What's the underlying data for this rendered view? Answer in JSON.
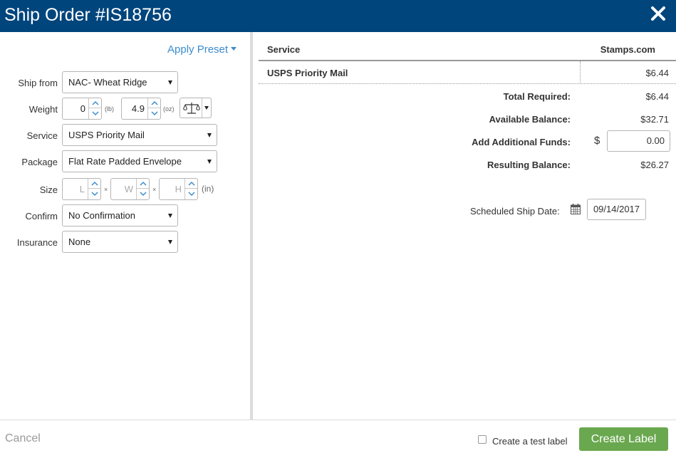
{
  "header": {
    "title": "Ship Order #IS18756",
    "close_icon": "close-icon"
  },
  "left": {
    "apply_preset": "Apply Preset",
    "ship_from": {
      "label": "Ship from",
      "value": "NAC- Wheat Ridge"
    },
    "weight": {
      "label": "Weight",
      "lb_value": "0",
      "lb_unit": "(lb)",
      "oz_value": "4.9",
      "oz_unit": "(oz)",
      "scale_icon": "scale-icon"
    },
    "service": {
      "label": "Service",
      "value": "USPS Priority Mail"
    },
    "package": {
      "label": "Package",
      "value": "Flat Rate Padded Envelope"
    },
    "size": {
      "label": "Size",
      "l_placeholder": "L",
      "w_placeholder": "W",
      "h_placeholder": "H",
      "times": "×",
      "unit": "(in)"
    },
    "confirm": {
      "label": "Confirm",
      "value": "No Confirmation"
    },
    "insurance": {
      "label": "Insurance",
      "value": "None"
    }
  },
  "right": {
    "table": {
      "col_service": "Service",
      "col_provider": "Stamps.com",
      "rows": [
        {
          "service": "USPS Priority Mail",
          "cost": "$6.44"
        }
      ]
    },
    "balance": {
      "total_required_label": "Total Required:",
      "total_required": "$6.44",
      "available_label": "Available Balance:",
      "available": "$32.71",
      "add_funds_label": "Add Additional Funds:",
      "currency": "$",
      "add_funds_value": "0.00",
      "resulting_label": "Resulting Balance:",
      "resulting": "$26.27"
    },
    "ship_date": {
      "label": "Scheduled Ship Date:",
      "icon": "calendar-icon",
      "value": "09/14/2017"
    }
  },
  "footer": {
    "cancel": "Cancel",
    "test_label": "Create a test label",
    "test_checked": false,
    "create_label": "Create Label"
  },
  "colors": {
    "header_bg": "#00457c",
    "link": "#3b8ccd",
    "primary_button": "#6aa84f"
  }
}
